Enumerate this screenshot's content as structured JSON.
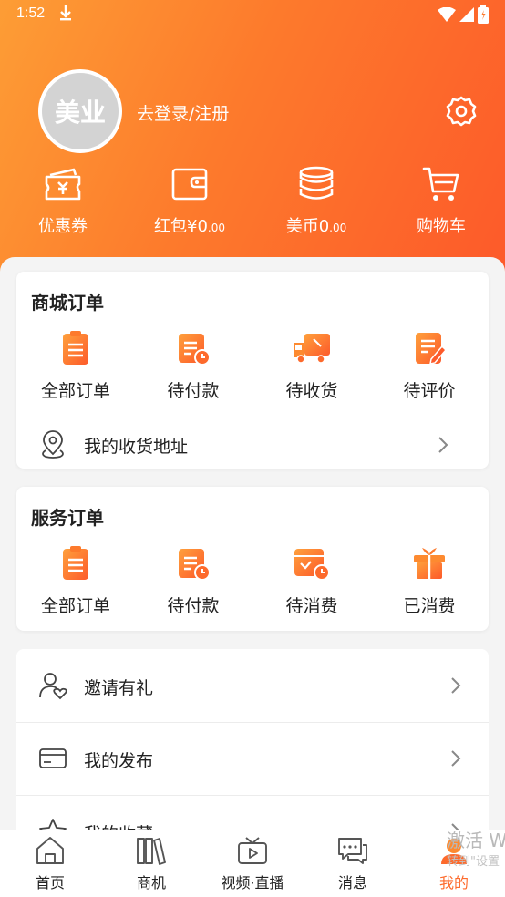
{
  "status": {
    "time": "1:52"
  },
  "profile": {
    "avatar_text": "美业",
    "login_label": "去登录/注册"
  },
  "wallet": [
    {
      "label": "优惠券"
    },
    {
      "label": "红包",
      "prefix": "¥",
      "value_int": "0",
      "value_dec": ".00"
    },
    {
      "label": "美币",
      "value_int": "0",
      "value_dec": ".00"
    },
    {
      "label": "购物车"
    }
  ],
  "mall_orders": {
    "title": "商城订单",
    "items": [
      {
        "label": "全部订单"
      },
      {
        "label": "待付款"
      },
      {
        "label": "待收货"
      },
      {
        "label": "待评价"
      }
    ],
    "address_label": "我的收货地址"
  },
  "service_orders": {
    "title": "服务订单",
    "items": [
      {
        "label": "全部订单"
      },
      {
        "label": "待付款"
      },
      {
        "label": "待消费"
      },
      {
        "label": "已消费"
      }
    ]
  },
  "menu": [
    {
      "label": "邀请有礼"
    },
    {
      "label": "我的发布"
    },
    {
      "label": "我的收藏"
    }
  ],
  "tabs": [
    {
      "label": "首页"
    },
    {
      "label": "商机"
    },
    {
      "label": "视频·直播"
    },
    {
      "label": "消息"
    },
    {
      "label": "我的"
    }
  ],
  "watermark": {
    "line1": "激活 W",
    "line2": "转到\"设置"
  },
  "colors": {
    "accent": "#fd6a2c",
    "header_start": "#fd9d35",
    "header_end": "#fd5a2a"
  }
}
